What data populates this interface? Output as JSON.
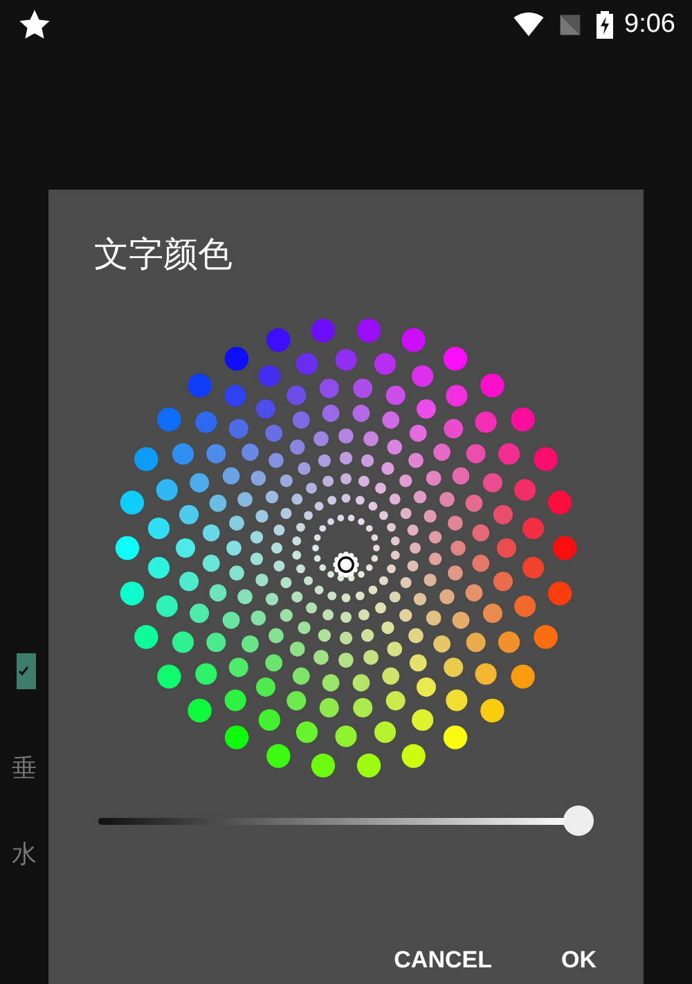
{
  "status_bar": {
    "time": "9:06"
  },
  "background": {
    "checkbox": {
      "checked": true
    },
    "labels": [
      "垂",
      "水"
    ]
  },
  "dialog": {
    "title": "文字颜色",
    "brightness": {
      "level": 1.0
    },
    "buttons": [
      {
        "label": "CANCEL"
      },
      {
        "label": "OK"
      }
    ]
  }
}
